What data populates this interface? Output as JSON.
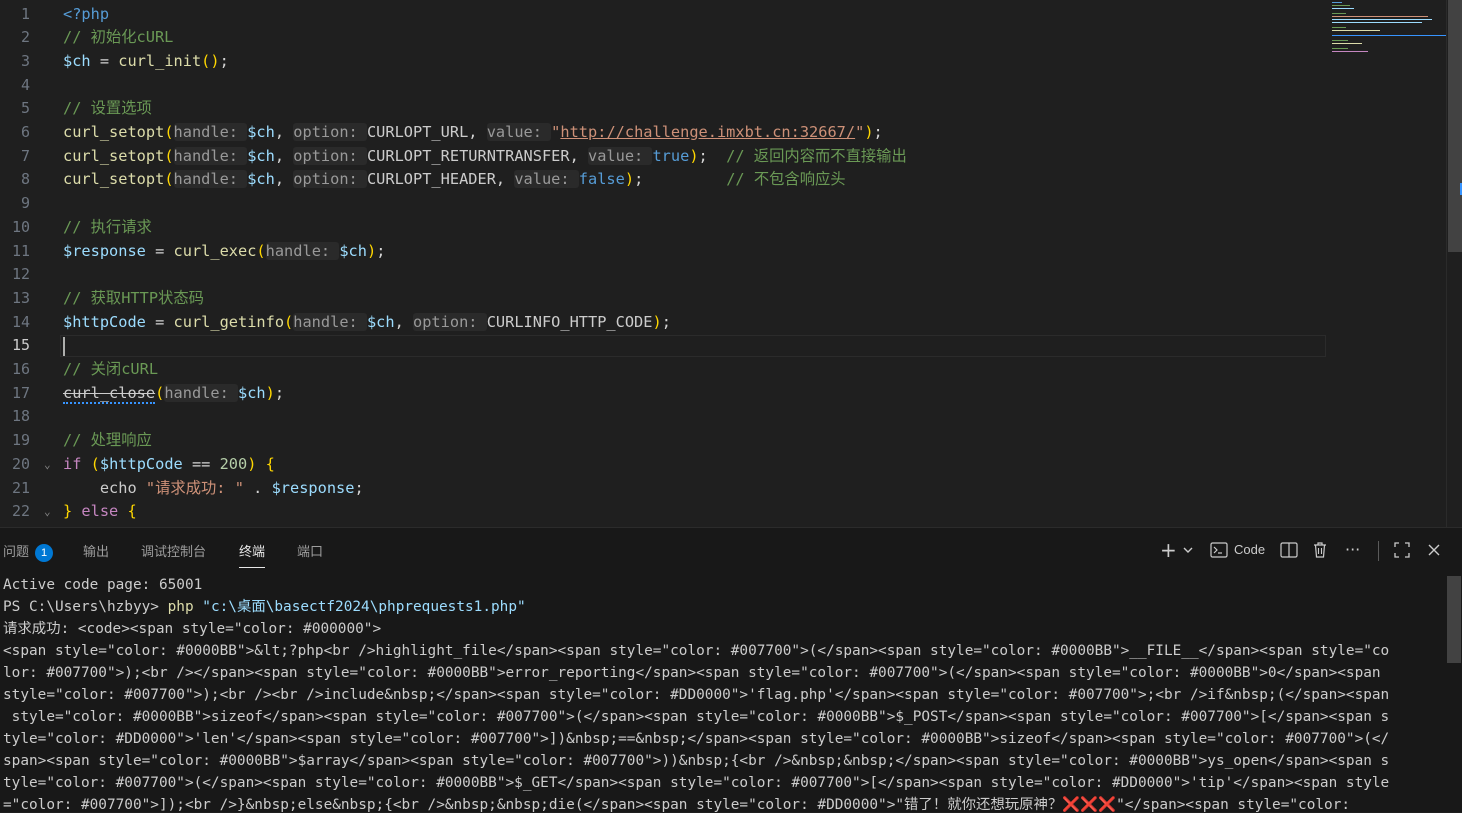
{
  "editor": {
    "active_line": 15,
    "lines": [
      {
        "n": "1",
        "tokens": [
          {
            "t": "<?php",
            "c": "t-bool"
          }
        ]
      },
      {
        "n": "2",
        "tokens": [
          {
            "t": "// 初始化cURL",
            "c": "t-com"
          }
        ]
      },
      {
        "n": "3",
        "tokens": [
          {
            "t": "$ch",
            "c": "t-var"
          },
          {
            "t": " = ",
            "c": "t-op"
          },
          {
            "t": "curl_init",
            "c": "t-fn"
          },
          {
            "t": "()",
            "c": "t-br1"
          },
          {
            "t": ";",
            "c": "t-op"
          }
        ]
      },
      {
        "n": "4",
        "tokens": []
      },
      {
        "n": "5",
        "tokens": [
          {
            "t": "// 设置选项",
            "c": "t-com"
          }
        ]
      },
      {
        "n": "6",
        "tokens": [
          {
            "t": "curl_setopt",
            "c": "t-fn"
          },
          {
            "t": "(",
            "c": "t-br1"
          },
          {
            "t": "handle: ",
            "c": "t-hint"
          },
          {
            "t": "$ch",
            "c": "t-var"
          },
          {
            "t": ", ",
            "c": "t-op"
          },
          {
            "t": "option: ",
            "c": "t-hint"
          },
          {
            "t": "CURLOPT_URL",
            "c": "t-plain"
          },
          {
            "t": ", ",
            "c": "t-op"
          },
          {
            "t": "value: ",
            "c": "t-hint"
          },
          {
            "t": "\"",
            "c": "t-str"
          },
          {
            "t": "http://challenge.imxbt.cn:32667/",
            "c": "t-url"
          },
          {
            "t": "\"",
            "c": "t-str"
          },
          {
            "t": ")",
            "c": "t-br1"
          },
          {
            "t": ";",
            "c": "t-op"
          }
        ]
      },
      {
        "n": "7",
        "tokens": [
          {
            "t": "curl_setopt",
            "c": "t-fn"
          },
          {
            "t": "(",
            "c": "t-br1"
          },
          {
            "t": "handle: ",
            "c": "t-hint"
          },
          {
            "t": "$ch",
            "c": "t-var"
          },
          {
            "t": ", ",
            "c": "t-op"
          },
          {
            "t": "option: ",
            "c": "t-hint"
          },
          {
            "t": "CURLOPT_RETURNTRANSFER",
            "c": "t-plain"
          },
          {
            "t": ", ",
            "c": "t-op"
          },
          {
            "t": "value: ",
            "c": "t-hint"
          },
          {
            "t": "true",
            "c": "t-bool"
          },
          {
            "t": ")",
            "c": "t-br1"
          },
          {
            "t": ";  ",
            "c": "t-op"
          },
          {
            "t": "// 返回内容而不直接输出",
            "c": "t-com"
          }
        ]
      },
      {
        "n": "8",
        "tokens": [
          {
            "t": "curl_setopt",
            "c": "t-fn"
          },
          {
            "t": "(",
            "c": "t-br1"
          },
          {
            "t": "handle: ",
            "c": "t-hint"
          },
          {
            "t": "$ch",
            "c": "t-var"
          },
          {
            "t": ", ",
            "c": "t-op"
          },
          {
            "t": "option: ",
            "c": "t-hint"
          },
          {
            "t": "CURLOPT_HEADER",
            "c": "t-plain"
          },
          {
            "t": ", ",
            "c": "t-op"
          },
          {
            "t": "value: ",
            "c": "t-hint"
          },
          {
            "t": "false",
            "c": "t-bool"
          },
          {
            "t": ")",
            "c": "t-br1"
          },
          {
            "t": ";         ",
            "c": "t-op"
          },
          {
            "t": "// 不包含响应头",
            "c": "t-com"
          }
        ]
      },
      {
        "n": "9",
        "tokens": []
      },
      {
        "n": "10",
        "tokens": [
          {
            "t": "// 执行请求",
            "c": "t-com"
          }
        ]
      },
      {
        "n": "11",
        "tokens": [
          {
            "t": "$response",
            "c": "t-var"
          },
          {
            "t": " = ",
            "c": "t-op"
          },
          {
            "t": "curl_exec",
            "c": "t-fn"
          },
          {
            "t": "(",
            "c": "t-br1"
          },
          {
            "t": "handle: ",
            "c": "t-hint"
          },
          {
            "t": "$ch",
            "c": "t-var"
          },
          {
            "t": ")",
            "c": "t-br1"
          },
          {
            "t": ";",
            "c": "t-op"
          }
        ]
      },
      {
        "n": "12",
        "tokens": []
      },
      {
        "n": "13",
        "tokens": [
          {
            "t": "// 获取HTTP状态码",
            "c": "t-com"
          }
        ]
      },
      {
        "n": "14",
        "tokens": [
          {
            "t": "$httpCode",
            "c": "t-var"
          },
          {
            "t": " = ",
            "c": "t-op"
          },
          {
            "t": "curl_getinfo",
            "c": "t-fn"
          },
          {
            "t": "(",
            "c": "t-br1"
          },
          {
            "t": "handle: ",
            "c": "t-hint"
          },
          {
            "t": "$ch",
            "c": "t-var"
          },
          {
            "t": ", ",
            "c": "t-op"
          },
          {
            "t": "option: ",
            "c": "t-hint"
          },
          {
            "t": "CURLINFO_HTTP_CODE",
            "c": "t-plain"
          },
          {
            "t": ")",
            "c": "t-br1"
          },
          {
            "t": ";",
            "c": "t-op"
          }
        ]
      },
      {
        "n": "15",
        "tokens": []
      },
      {
        "n": "16",
        "tokens": [
          {
            "t": "// 关闭cURL",
            "c": "t-com"
          }
        ]
      },
      {
        "n": "17",
        "tokens": [
          {
            "t": "curl_close",
            "c": "t-deprecated"
          },
          {
            "t": "(",
            "c": "t-br1"
          },
          {
            "t": "handle: ",
            "c": "t-hint"
          },
          {
            "t": "$ch",
            "c": "t-var"
          },
          {
            "t": ")",
            "c": "t-br1"
          },
          {
            "t": ";",
            "c": "t-op"
          }
        ]
      },
      {
        "n": "18",
        "tokens": []
      },
      {
        "n": "19",
        "tokens": [
          {
            "t": "// 处理响应",
            "c": "t-com"
          }
        ]
      },
      {
        "n": "20",
        "fold": "⌄",
        "tokens": [
          {
            "t": "if",
            "c": "t-kw"
          },
          {
            "t": " ",
            "c": "t-op"
          },
          {
            "t": "(",
            "c": "t-br1"
          },
          {
            "t": "$httpCode",
            "c": "t-var"
          },
          {
            "t": " == ",
            "c": "t-op"
          },
          {
            "t": "200",
            "c": "t-num"
          },
          {
            "t": ")",
            "c": "t-br1"
          },
          {
            "t": " ",
            "c": "t-op"
          },
          {
            "t": "{",
            "c": "t-br1"
          }
        ]
      },
      {
        "n": "21",
        "tokens": [
          {
            "t": "    echo ",
            "c": "t-plain"
          },
          {
            "t": "\"请求成功: \"",
            "c": "t-str"
          },
          {
            "t": " . ",
            "c": "t-op"
          },
          {
            "t": "$response",
            "c": "t-var"
          },
          {
            "t": ";",
            "c": "t-op"
          }
        ]
      },
      {
        "n": "22",
        "fold": "⌄",
        "tokens": [
          {
            "t": "}",
            "c": "t-br1"
          },
          {
            "t": " else ",
            "c": "t-kw"
          },
          {
            "t": "{",
            "c": "t-br1"
          }
        ]
      }
    ]
  },
  "panel": {
    "tabs": [
      {
        "label": "问题",
        "badge": "1"
      },
      {
        "label": "输出"
      },
      {
        "label": "调试控制台"
      },
      {
        "label": "终端",
        "active": true
      },
      {
        "label": "端口"
      }
    ],
    "terminal_profile": "Code",
    "icons": [
      "plus-icon",
      "chevron-down-icon",
      "terminal-icon",
      "split-icon",
      "trash-icon",
      "more-icon",
      "maximize-icon",
      "close-icon"
    ]
  },
  "terminal": {
    "lines": [
      [
        {
          "t": "Active code page: 65001"
        }
      ],
      [
        {
          "t": "PS C:\\Users\\hzbyy> "
        },
        {
          "t": "php",
          "c": "tcmd"
        },
        {
          "t": " "
        },
        {
          "t": "\"c:\\桌面\\basectf2024\\phprequests1.php\"",
          "c": "tpath"
        }
      ],
      [
        {
          "t": "请求成功: <code><span style=\"color: #000000\">"
        }
      ],
      [
        {
          "t": "<span style=\"color: #0000BB\">&lt;?php<br />highlight_file</span><span style=\"color: #007700\">(</span><span style=\"color: #0000BB\">__FILE__</span><span style=\"co"
        }
      ],
      [
        {
          "t": "lor: #007700\">);<br /></span><span style=\"color: #0000BB\">error_reporting</span><span style=\"color: #007700\">(</span><span style=\"color: #0000BB\">0</span><span "
        }
      ],
      [
        {
          "t": "style=\"color: #007700\">);<br /><br />include&nbsp;</span><span style=\"color: #DD0000\">'flag.php'</span><span style=\"color: #007700\">;<br />if&nbsp;(</span><span"
        }
      ],
      [
        {
          "t": " style=\"color: #0000BB\">sizeof</span><span style=\"color: #007700\">(</span><span style=\"color: #0000BB\">$_POST</span><span style=\"color: #007700\">[</span><span s"
        }
      ],
      [
        {
          "t": "tyle=\"color: #DD0000\">'len'</span><span style=\"color: #007700\">])&nbsp;==&nbsp;</span><span style=\"color: #0000BB\">sizeof</span><span style=\"color: #007700\">(</"
        }
      ],
      [
        {
          "t": "span><span style=\"color: #0000BB\">$array</span><span style=\"color: #007700\">))&nbsp;{<br />&nbsp;&nbsp;</span><span style=\"color: #0000BB\">ys_open</span><span s"
        }
      ],
      [
        {
          "t": "tyle=\"color: #007700\">(</span><span style=\"color: #0000BB\">$_GET</span><span style=\"color: #007700\">[</span><span style=\"color: #DD0000\">'tip'</span><span style"
        }
      ],
      [
        {
          "t": "=\"color: #007700\">]);<br />}&nbsp;else&nbsp;{<br />&nbsp;&nbsp;die(</span><span style=\"color: #DD0000\">\"错了！就你还想玩原神？"
        },
        {
          "t": "❌❌❌",
          "c": "tpink"
        },
        {
          "t": "\"</span><span style=\"color:"
        }
      ]
    ]
  }
}
